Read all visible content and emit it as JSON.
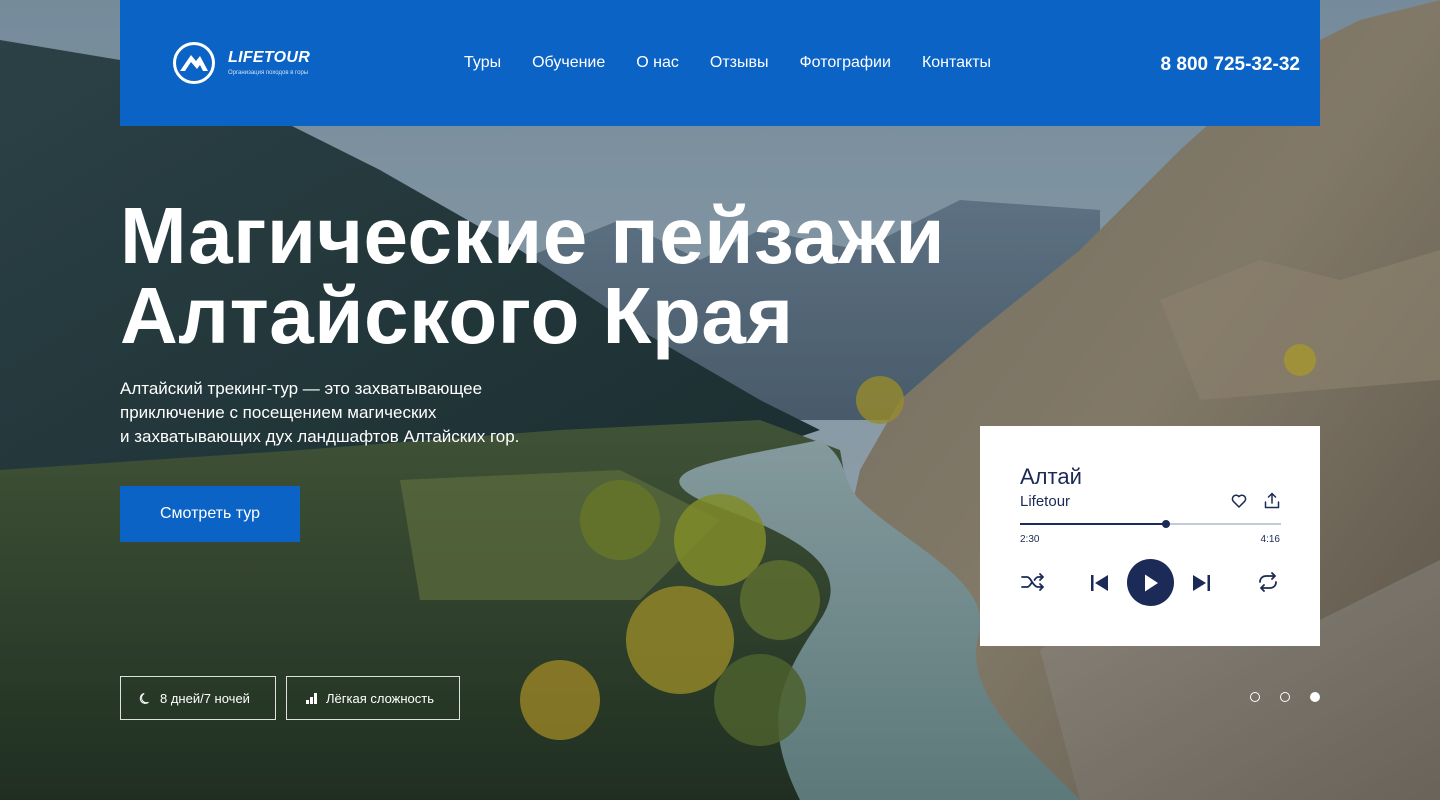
{
  "brand": {
    "name": "LIFETOUR",
    "tagline": "Организация походов в горы"
  },
  "nav": {
    "items": [
      "Туры",
      "Обучение",
      "О нас",
      "Отзывы",
      "Фотографии",
      "Контакты"
    ]
  },
  "phone": "8 800 725-32-32",
  "hero": {
    "title_line1": "Магические пейзажи",
    "title_line2": "Алтайского Края",
    "description_line1": "Алтайский трекинг-тур — это захватывающее",
    "description_line2": "приключение с посещением магических",
    "description_line3": "и захватывающих дух ландшафтов Алтайских гор.",
    "cta_label": "Смотреть тур"
  },
  "chips": {
    "duration": "8 дней/7 ночей",
    "difficulty": "Лёгкая сложность"
  },
  "slider": {
    "count": 3,
    "active_index": 2
  },
  "player": {
    "title": "Алтай",
    "artist": "Lifetour",
    "current_time": "2:30",
    "duration": "4:16",
    "progress": 0.56
  },
  "colors": {
    "brand_blue": "#0b63c5",
    "player_navy": "#1b2a56"
  }
}
